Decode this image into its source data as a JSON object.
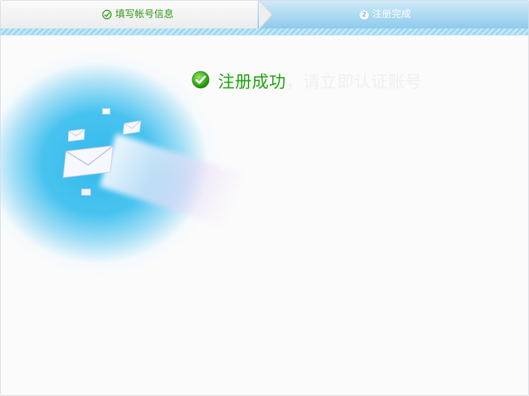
{
  "steps": [
    {
      "label": "填写帐号信息",
      "status": "done"
    },
    {
      "number": "2",
      "label": "注册完成",
      "status": "current"
    }
  ],
  "result": {
    "title": "注册成功",
    "subtitle": "，请立即认证账号"
  },
  "colors": {
    "success_green": "#1fa40e",
    "step_blue": "#8fcbec",
    "stripe_blue": "#9cd7f0"
  },
  "icons": [
    "check-circle-icon",
    "step-number-icon",
    "success-check-icon",
    "envelope-icon"
  ]
}
